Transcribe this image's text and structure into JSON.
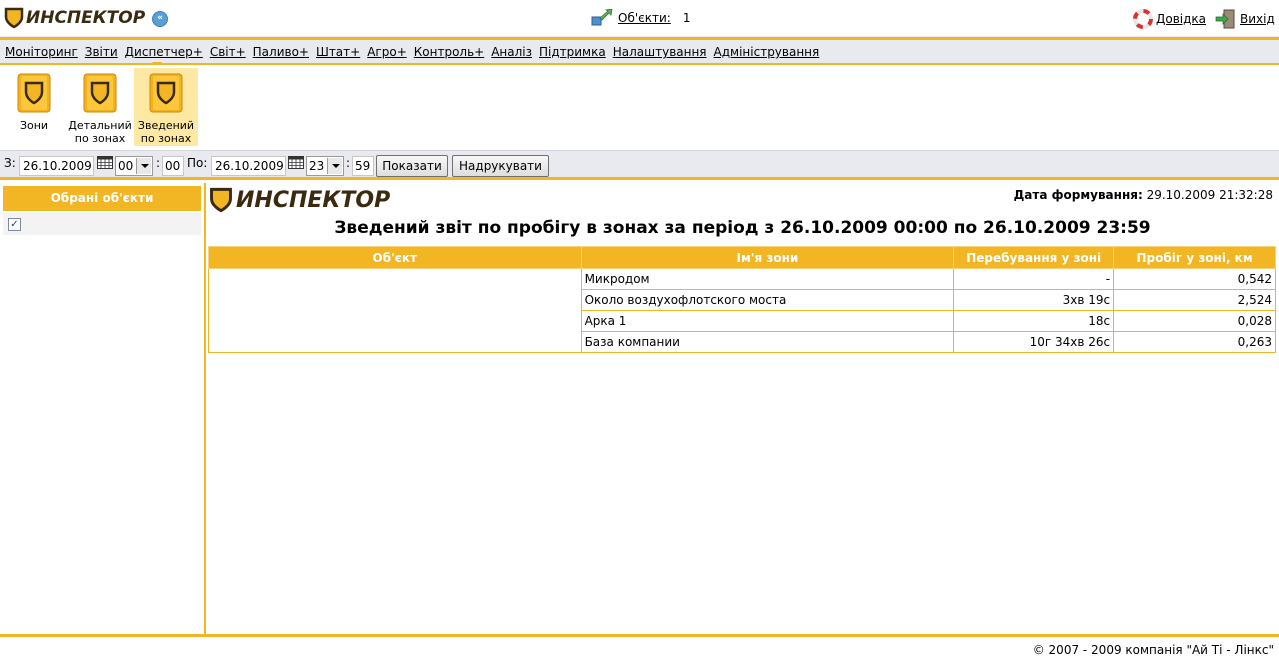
{
  "header": {
    "logo_text": "ИНСПЕКТОР",
    "objects_label": "Об'єкти:",
    "objects_count": "1",
    "help_label": "Довідка",
    "exit_label": "Вихід"
  },
  "menu": {
    "items": [
      {
        "label": "Моніторинг"
      },
      {
        "label": "Звіти"
      },
      {
        "label": "Диспетчер+"
      },
      {
        "label": "Світ+"
      },
      {
        "label": "Паливо+"
      },
      {
        "label": "Штат+"
      },
      {
        "label": "Агро+"
      },
      {
        "label": "Контроль+"
      },
      {
        "label": "Аналіз"
      },
      {
        "label": "Підтримка"
      },
      {
        "label": "Налаштування"
      },
      {
        "label": "Адміністрування"
      }
    ]
  },
  "toolbar": {
    "tools": [
      {
        "line1": "Зони",
        "line2": ""
      },
      {
        "line1": "Детальний",
        "line2": "по зонах"
      },
      {
        "line1": "Зведений",
        "line2": "по зонах",
        "active": true
      }
    ]
  },
  "filter": {
    "from_label": "З:",
    "from_date": "26.10.2009",
    "from_hour": "00",
    "from_min": "00",
    "to_label": "По:",
    "to_date": "26.10.2009",
    "to_hour": "23",
    "to_min": "59",
    "show_button": "Показати",
    "print_button": "Надрукувати",
    "colon": ":"
  },
  "left_panel": {
    "title": "Обрані об'єкти",
    "checked": true
  },
  "report": {
    "logo_text": "ИНСПЕКТОР",
    "gen_label": "Дата формування:",
    "gen_value": "29.10.2009 21:32:28",
    "title": "Зведений звіт по пробігу в зонах за період з 26.10.2009 00:00 по 26.10.2009 23:59",
    "columns": [
      "Об'єкт",
      "Ім'я зони",
      "Перебування у зоні",
      "Пробіг у зоні, км"
    ],
    "rows": [
      {
        "zone": "Микродом",
        "stay": "-",
        "mileage": "0,542"
      },
      {
        "zone": "Около воздухофлотского моста",
        "stay": "3хв 19с",
        "mileage": "2,524"
      },
      {
        "zone": "Арка 1",
        "stay": "18с",
        "mileage": "0,028"
      },
      {
        "zone": "База компании",
        "stay": "10г 34хв 26с",
        "mileage": "0,263"
      }
    ],
    "object_name": ""
  },
  "footer": {
    "copyright": "© 2007 - 2009 компанія \"Ай Ті - Лінкс\""
  },
  "colors": {
    "accent": "#f2b523",
    "bar_bg": "#e9eaf0",
    "logo_dark": "#3a2a10"
  }
}
